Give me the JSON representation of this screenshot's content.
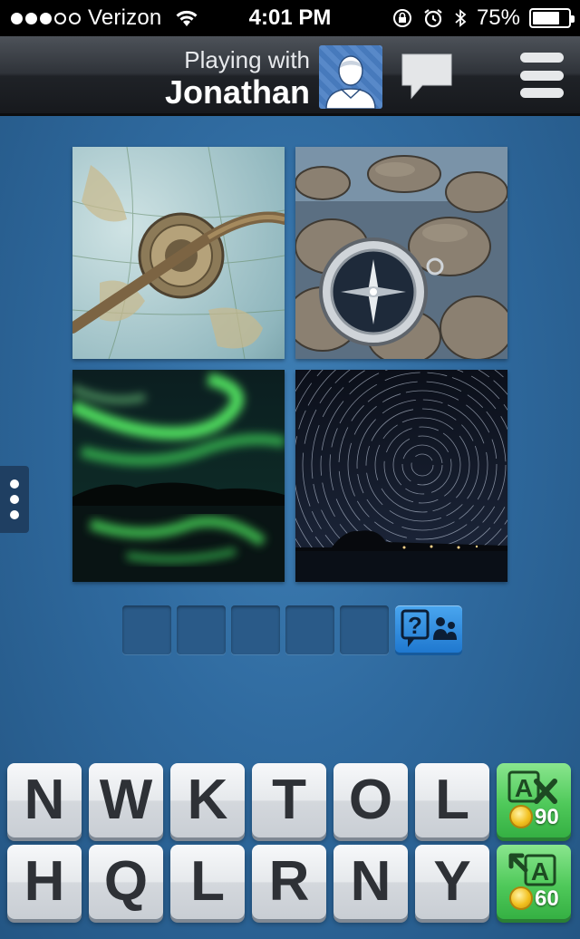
{
  "status_bar": {
    "carrier": "Verizon",
    "time": "4:01 PM",
    "battery_percent": "75%",
    "battery_level": 0.75,
    "signal_bars_filled": 3,
    "signal_bars_total": 5
  },
  "header": {
    "playing_with_label": "Playing with",
    "player_name": "Jonathan",
    "avatar_icon": "person-silhouette-icon",
    "chat_icon": "speech-bubble-icon",
    "menu_icon": "hamburger-menu-icon"
  },
  "puzzle": {
    "pictures": [
      {
        "subject": "globe-with-compass",
        "alt": "Globe with a brass compass"
      },
      {
        "subject": "compass-on-rocks",
        "alt": "Compass on rocks"
      },
      {
        "subject": "aurora-borealis",
        "alt": "Northern lights over water"
      },
      {
        "subject": "star-trails",
        "alt": "Circular star trails"
      }
    ],
    "answer_length": 5,
    "answer_letters": [
      "",
      "",
      "",
      "",
      ""
    ],
    "help_icon": "ask-friends-icon"
  },
  "keyboard": {
    "row1": [
      "N",
      "W",
      "K",
      "T",
      "O",
      "L"
    ],
    "row2": [
      "H",
      "Q",
      "L",
      "R",
      "N",
      "Y"
    ]
  },
  "powerups": {
    "remove_letters": {
      "icon": "remove-letters-icon",
      "cost": "90"
    },
    "reveal_letter": {
      "icon": "reveal-letter-icon",
      "cost": "60"
    }
  },
  "colors": {
    "background": "#2f6a9f",
    "key_face": "#e6e9ec",
    "powerup_green": "#4fc95a",
    "help_blue": "#1f78cf"
  }
}
